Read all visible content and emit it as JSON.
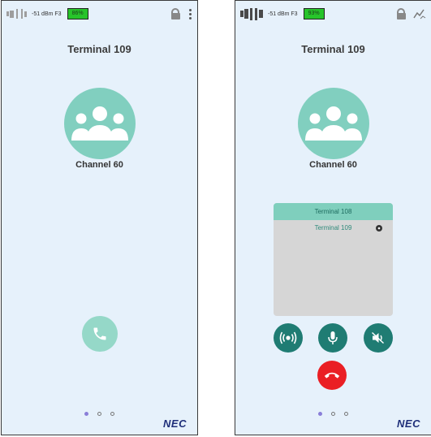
{
  "screens": [
    {
      "status": {
        "signal": "-51 dBm F3",
        "battery": "86%"
      },
      "terminal_title": "Terminal 109",
      "channel_label": "Channel 60",
      "brand": "NEC"
    },
    {
      "status": {
        "signal": "-51 dBm F3",
        "battery": "93%"
      },
      "terminal_title": "Terminal 109",
      "channel_label": "Channel 60",
      "participants": {
        "header": "Terminal 108",
        "rows": [
          "Terminal 109"
        ]
      },
      "brand": "NEC"
    }
  ],
  "icons": {
    "lock": "unlock-icon",
    "menu": "more-vertical-icon",
    "stats": "signal-chart-icon",
    "group": "group-icon",
    "call": "phone-icon",
    "ptt": "broadcast-icon",
    "mic": "microphone-icon",
    "mute": "speaker-mute-icon",
    "end": "end-call-icon"
  },
  "colors": {
    "background": "#e6f1fb",
    "avatar": "#81cfbf",
    "call_button": "#95d8c8",
    "control_button": "#1f7c73",
    "end_call": "#ea1f24",
    "battery": "#27c42a",
    "brand": "#1f2f7a"
  }
}
